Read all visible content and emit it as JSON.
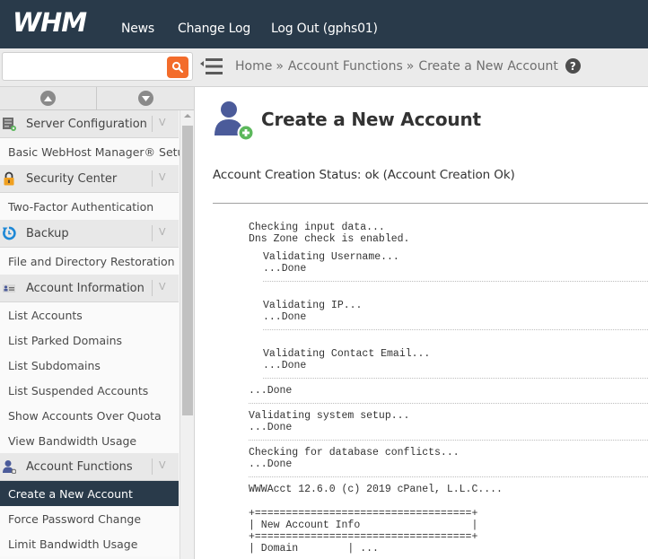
{
  "app": {
    "logo_text": "WHM",
    "colors": {
      "topbar": "#293a4a",
      "search_button": "#f36c2b",
      "active_item": "#293a4a",
      "page_icon": "#4b5b9a",
      "plus_badge": "#5cb85c"
    }
  },
  "topnav": {
    "links": [
      {
        "label": "News"
      },
      {
        "label": "Change Log"
      },
      {
        "label": "Log Out (gphs01)"
      }
    ]
  },
  "search": {
    "value": "",
    "placeholder": "",
    "icon": "search-icon"
  },
  "breadcrumb": {
    "items": [
      "Home",
      "Account Functions",
      "Create a New Account"
    ],
    "separator": "»",
    "help_icon": "?"
  },
  "sidebar": {
    "categories": [
      {
        "label": "Server Configuration",
        "icon": "server-config-icon",
        "items": [
          "Basic WebHost Manager® Setup"
        ]
      },
      {
        "label": "Security Center",
        "icon": "lock-icon",
        "items": [
          "Two-Factor Authentication"
        ]
      },
      {
        "label": "Backup",
        "icon": "backup-icon",
        "items": [
          "File and Directory Restoration"
        ]
      },
      {
        "label": "Account Information",
        "icon": "account-info-icon",
        "items": [
          "List Accounts",
          "List Parked Domains",
          "List Subdomains",
          "List Suspended Accounts",
          "Show Accounts Over Quota",
          "View Bandwidth Usage"
        ]
      },
      {
        "label": "Account Functions",
        "icon": "account-functions-icon",
        "items": [
          "Create a New Account",
          "Force Password Change",
          "Limit Bandwidth Usage"
        ]
      }
    ],
    "active_item": "Create a New Account",
    "chevron": "V"
  },
  "main": {
    "title": "Create a New Account",
    "status": "Account Creation Status: ok (Account Creation Ok)",
    "log": {
      "intro": [
        "Checking input data...",
        "Dns Zone check is enabled."
      ],
      "validations": [
        {
          "task": "Validating Username...",
          "result": "...Done"
        },
        {
          "task": "Validating IP...",
          "result": "...Done"
        },
        {
          "task": "Validating Contact Email...",
          "result": "...Done"
        }
      ],
      "input_done": "...Done",
      "system_setup": {
        "task": "Validating system setup...",
        "result": "...Done"
      },
      "db_conflicts": {
        "task": "Checking for database conflicts...",
        "result": "...Done"
      },
      "version": "WWWAcct 12.6.0 (c) 2019 cPanel, L.L.C....",
      "table": {
        "border": "+===================================+",
        "title_row": "| New Account Info                  |",
        "next_row": "| Domain        | ..."
      }
    }
  }
}
